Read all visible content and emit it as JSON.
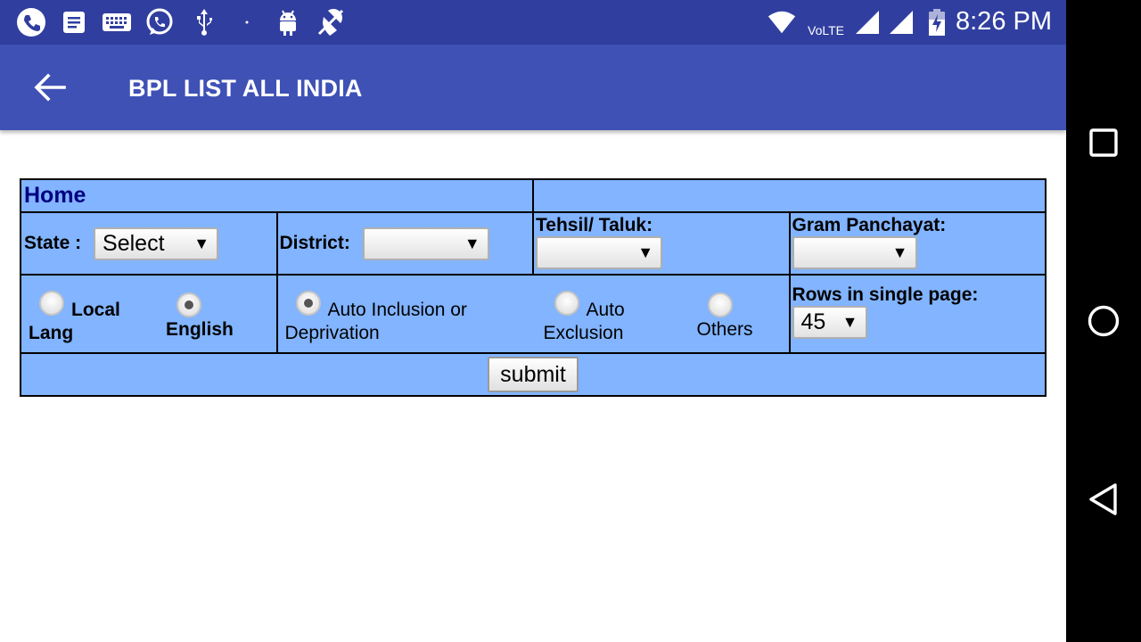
{
  "status_bar": {
    "time": "8:26 PM",
    "network_label": "VoLTE",
    "icons": [
      "phone-icon",
      "notes-icon",
      "keyboard-icon",
      "whatsapp-icon",
      "usb-icon",
      "dot-icon",
      "android-icon",
      "no-location-icon",
      "wifi-icon",
      "signal-icon",
      "signal-icon",
      "battery-charging-icon"
    ]
  },
  "app_bar": {
    "title": "BPL LIST ALL INDIA",
    "back_icon": "arrow-back-icon"
  },
  "form": {
    "home_label": "Home",
    "state_label": "State :",
    "state_value": "Select",
    "district_label": "District:",
    "district_value": "",
    "tehsil_label": "Tehsil/ Taluk:",
    "tehsil_value": "",
    "gram_label": "Gram Panchayat:",
    "gram_value": "",
    "language_options": [
      {
        "label_line1": "Local",
        "label_line2": "Lang",
        "checked": false
      },
      {
        "label": "English",
        "checked": true
      }
    ],
    "category_options": [
      {
        "label_line1": "Auto Inclusion or",
        "label_line2": "Deprivation",
        "checked": true
      },
      {
        "label_line1": "Auto",
        "label_line2": "Exclusion",
        "checked": false
      },
      {
        "label": "Others",
        "checked": false
      }
    ],
    "rows_label": "Rows in single page:",
    "rows_value": "45",
    "submit_label": "submit"
  },
  "nav_bar": {
    "icons": [
      "recent-apps-icon",
      "home-icon",
      "back-icon"
    ]
  },
  "colors": {
    "status_bar": "#303f9f",
    "app_bar": "#3f51b5",
    "form_background": "#82b4ff",
    "home_label": "#000080"
  }
}
